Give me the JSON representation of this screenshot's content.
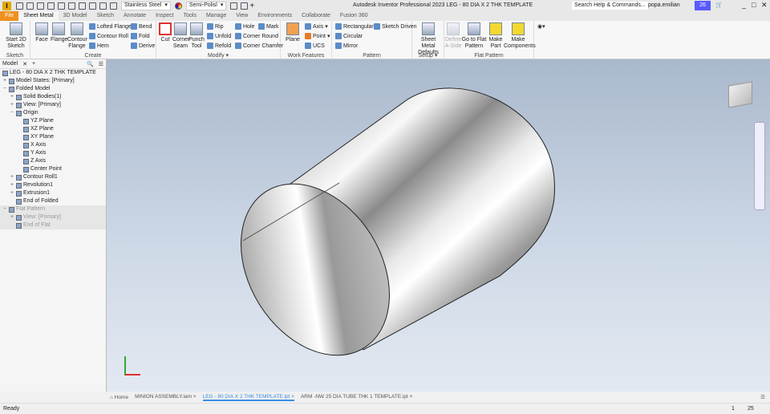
{
  "titlebar": {
    "material": "Stainless Steel",
    "appearance": "Semi-Polisl",
    "title": "Autodesk Inventor Professional 2023   LEG - 80 DIA X  2 THK TEMPLATE",
    "search_placeholder": "Search Help & Commands...",
    "user": "popa.emilian",
    "clock_count": "26"
  },
  "tabs": [
    "File",
    "Sheet Metal",
    "3D Model",
    "Sketch",
    "Annotate",
    "Inspect",
    "Tools",
    "Manage",
    "View",
    "Environments",
    "Collaborate",
    "Fusion 360"
  ],
  "ribbon": {
    "sketch": {
      "label": "Sketch",
      "start": "Start 2D Sketch"
    },
    "create": {
      "label": "Create",
      "face": "Face",
      "flange": "Flange",
      "contour_flange": "Contour Flange",
      "lofted_flange": "Lofted Flange",
      "contour_roll": "Contour Roll",
      "hem": "Hem",
      "bend": "Bend",
      "fold": "Fold",
      "derive": "Derive"
    },
    "modify": {
      "label": "Modify",
      "cut": "Cut",
      "corner_seam": "Corner Seam",
      "punch_tool": "Punch Tool",
      "rip": "Rip",
      "unfold": "Unfold",
      "refold": "Refold",
      "hole": "Hole",
      "corner_round": "Corner Round",
      "corner_chamfer": "Corner Chamfer",
      "mark": "Mark"
    },
    "work": {
      "label": "Work Features",
      "plane": "Plane",
      "axis": "Axis",
      "point": "Point",
      "ucs": "UCS"
    },
    "pattern": {
      "label": "Pattern",
      "rectangular": "Rectangular",
      "circular": "Circular",
      "mirror": "Mirror",
      "sketch_driven": "Sketch Driven"
    },
    "setup": {
      "label": "Setup",
      "defaults": "Sheet Metal Defaults"
    },
    "flat": {
      "label": "Flat Pattern",
      "define": "Define A-Side",
      "goto": "Go to Flat Pattern",
      "make_part": "Make Part",
      "make_components": "Make Components"
    }
  },
  "browser": {
    "tab": "Model",
    "root": "LEG - 80 DIA X  2 THK TEMPLATE",
    "nodes": [
      {
        "label": "Model States: [Primary]",
        "depth": 0,
        "exp": "+"
      },
      {
        "label": "Folded Model",
        "depth": 0,
        "exp": "−"
      },
      {
        "label": "Solid Bodies(1)",
        "depth": 1,
        "exp": "+"
      },
      {
        "label": "View: [Primary]",
        "depth": 1,
        "exp": "+"
      },
      {
        "label": "Origin",
        "depth": 1,
        "exp": "−"
      },
      {
        "label": "YZ Plane",
        "depth": 2,
        "exp": ""
      },
      {
        "label": "XZ Plane",
        "depth": 2,
        "exp": ""
      },
      {
        "label": "XY Plane",
        "depth": 2,
        "exp": ""
      },
      {
        "label": "X Axis",
        "depth": 2,
        "exp": ""
      },
      {
        "label": "Y Axis",
        "depth": 2,
        "exp": ""
      },
      {
        "label": "Z Axis",
        "depth": 2,
        "exp": ""
      },
      {
        "label": "Center Point",
        "depth": 2,
        "exp": ""
      },
      {
        "label": "Contour Roll1",
        "depth": 1,
        "exp": "+"
      },
      {
        "label": "Revolution1",
        "depth": 1,
        "exp": "+"
      },
      {
        "label": "Extrusion1",
        "depth": 1,
        "exp": "+"
      },
      {
        "label": "End of Folded",
        "depth": 1,
        "exp": ""
      },
      {
        "label": "Flat Pattern",
        "depth": 0,
        "exp": "−",
        "gray": true
      },
      {
        "label": "View: [Primary]",
        "depth": 1,
        "exp": "+",
        "gray": true
      },
      {
        "label": "End of Flat",
        "depth": 1,
        "exp": "",
        "gray": true
      }
    ]
  },
  "doctabs": {
    "home": "Home",
    "tabs": [
      "MINION ASSEMBLY.iam ×",
      "LEG - 80 DIA X  2 THK TEMPLATE.ipt ×",
      "ARM -NW 25 DIA TUBE THK 1 TEMPLATE.ipt ×"
    ],
    "active": 1
  },
  "status": {
    "text": "Ready",
    "n1": "1",
    "n2": "25"
  }
}
